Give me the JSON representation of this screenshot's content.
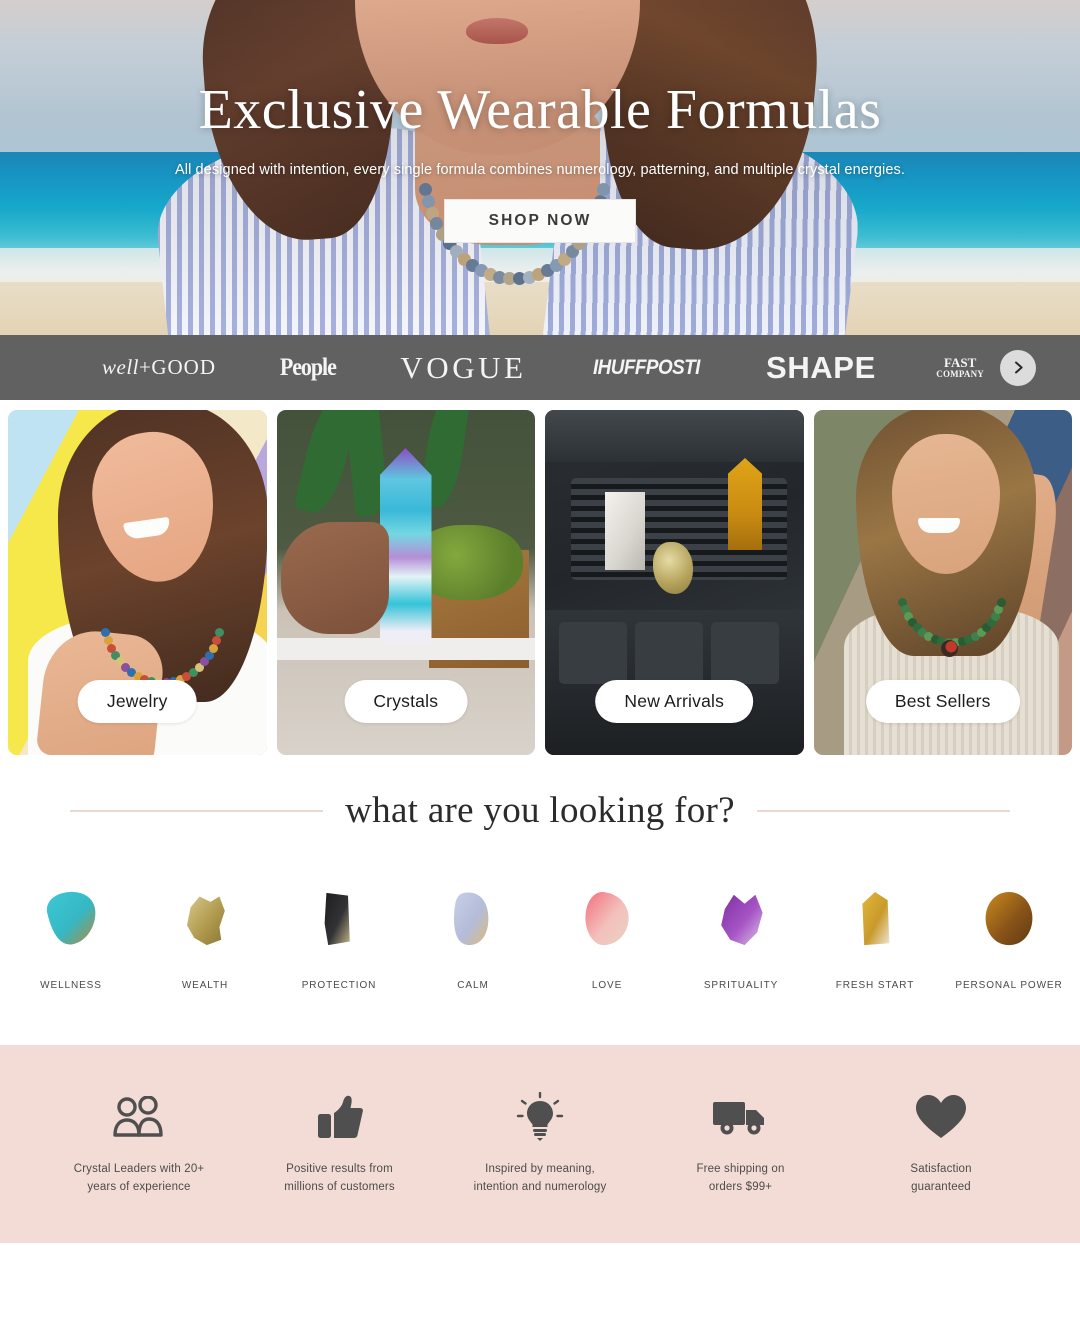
{
  "hero": {
    "title": "Exclusive Wearable Formulas",
    "subtitle": "All designed with intention, every single formula combines numerology, patterning, and multiple crystal energies.",
    "cta_label": "SHOP NOW"
  },
  "press_bar": {
    "background_color": "#616161",
    "logos": [
      {
        "name": "well-good",
        "text_italic": "well",
        "text_plus": "+",
        "text_bold": "GOOD"
      },
      {
        "name": "people",
        "text": "People"
      },
      {
        "name": "vogue",
        "text": "VOGUE"
      },
      {
        "name": "huffpost",
        "text": "IHUFFPOSTI"
      },
      {
        "name": "shape",
        "text": "SHAPE"
      },
      {
        "name": "fast-company",
        "line1": "FAST",
        "line2": "COMPANY"
      }
    ],
    "next_icon": "chevron-right-icon"
  },
  "category_tiles": [
    {
      "label": "Jewelry"
    },
    {
      "label": "Crystals"
    },
    {
      "label": "New Arrivals"
    },
    {
      "label": "Best Sellers"
    }
  ],
  "looking_for": {
    "title": "what are you looking for?",
    "rule_color": "#ead9d3",
    "crystals": [
      {
        "label": "WELLNESS",
        "stone": "turquoise",
        "colors": [
          "#3ec8d6",
          "#35b8c4",
          "#b08a3e"
        ]
      },
      {
        "label": "WEALTH",
        "stone": "pyrite",
        "colors": [
          "#d8c88a",
          "#b09a4e",
          "#8a7636"
        ]
      },
      {
        "label": "PROTECTION",
        "stone": "black-tourmaline",
        "colors": [
          "#1d1d1f",
          "#333337",
          "#c3b48a"
        ]
      },
      {
        "label": "CALM",
        "stone": "blue-lace-agate",
        "colors": [
          "#c9cfe6",
          "#b3bcd9",
          "#d9bb7c"
        ]
      },
      {
        "label": "LOVE",
        "stone": "pink-agate-geode",
        "colors": [
          "#f2707e",
          "#f3c0bb",
          "#e8d3c2"
        ]
      },
      {
        "label": "SPRITUALITY",
        "stone": "amethyst",
        "colors": [
          "#7b2fa0",
          "#a855c6",
          "#d8c8e6"
        ]
      },
      {
        "label": "FRESH START",
        "stone": "rutilated-quartz",
        "colors": [
          "#e2b63a",
          "#c99a2c",
          "#efe6d2"
        ]
      },
      {
        "label": "PERSONAL POWER",
        "stone": "tigers-eye",
        "colors": [
          "#c98b1e",
          "#8a5418",
          "#5e3a12"
        ]
      }
    ]
  },
  "benefits": {
    "background_color": "#f3dcd5",
    "items": [
      {
        "icon": "people-icon",
        "line1": "Crystal Leaders with 20+",
        "line2": "years of experience"
      },
      {
        "icon": "thumbs-up-icon",
        "line1": "Positive results from",
        "line2": "millions of customers"
      },
      {
        "icon": "lightbulb-icon",
        "line1": "Inspired by meaning,",
        "line2": "intention and numerology"
      },
      {
        "icon": "truck-icon",
        "line1": "Free shipping on",
        "line2": "orders $99+"
      },
      {
        "icon": "heart-icon",
        "line1": "Satisfaction",
        "line2": "guaranteed"
      }
    ]
  }
}
